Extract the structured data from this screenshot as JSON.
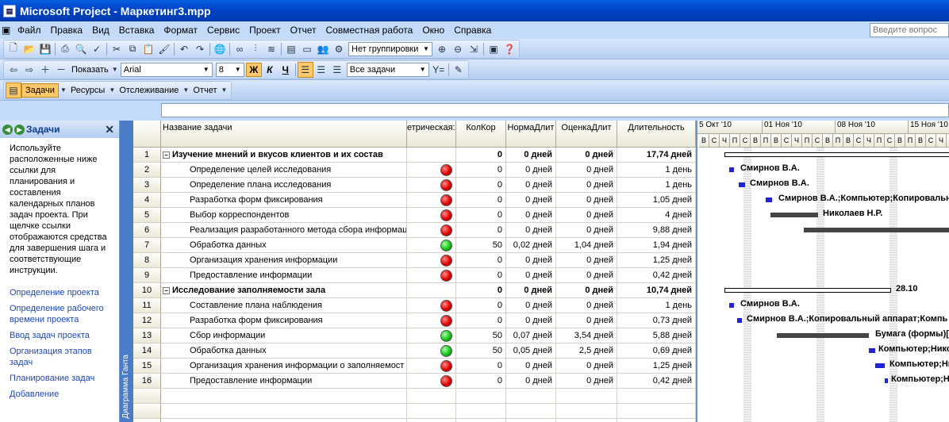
{
  "window": {
    "title": "Microsoft Project - Маркетинг3.mpp",
    "ask_placeholder": "Введите вопрос"
  },
  "menu": [
    "Файл",
    "Правка",
    "Вид",
    "Вставка",
    "Формат",
    "Сервис",
    "Проект",
    "Отчет",
    "Совместная работа",
    "Окно",
    "Справка"
  ],
  "toolbar": {
    "grouping": "Нет группировки",
    "show_label": "Показать",
    "font": "Arial",
    "size": "8",
    "bold": "Ж",
    "italic": "К",
    "underline": "Ч",
    "filter": "Все задачи"
  },
  "viewbar": {
    "tasks": "Задачи",
    "resources": "Ресурсы",
    "tracking": "Отслеживание",
    "report": "Отчет"
  },
  "pane": {
    "title": "Задачи",
    "description": "Используйте расположенные ниже ссылки для планирования и составления календарных планов задач проекта. При щелчке ссылки отображаются средства для завершения шага и соответствующие инструкции.",
    "links": [
      "Определение проекта",
      "Определение рабочего времени проекта",
      "Ввод задач проекта",
      "Организация этапов задач",
      "Планирование задач",
      "Добавление"
    ]
  },
  "vertical_label": "Диаграмма Ганта",
  "columns": [
    "Название задачи",
    "етрическая:",
    "КолКор",
    "НормаДлит",
    "ОценкаДлит",
    "Длительность"
  ],
  "rows": [
    {
      "id": "1",
      "name": "Изучение мнений и вкусов клиентов и их состав",
      "summary": true,
      "ind": "",
      "kk": "0",
      "nd": "0 дней",
      "od": "0 дней",
      "dur": "17,74 дней"
    },
    {
      "id": "2",
      "name": "Определение целей исследования",
      "summary": false,
      "ind": "red",
      "kk": "0",
      "nd": "0 дней",
      "od": "0 дней",
      "dur": "1 день"
    },
    {
      "id": "3",
      "name": "Определение плана исследования",
      "summary": false,
      "ind": "red",
      "kk": "0",
      "nd": "0 дней",
      "od": "0 дней",
      "dur": "1 день"
    },
    {
      "id": "4",
      "name": "Разработка форм фиксирования",
      "summary": false,
      "ind": "red",
      "kk": "0",
      "nd": "0 дней",
      "od": "0 дней",
      "dur": "1,05 дней"
    },
    {
      "id": "5",
      "name": "Выбор корреспондентов",
      "summary": false,
      "ind": "red",
      "kk": "0",
      "nd": "0 дней",
      "od": "0 дней",
      "dur": "4 дней"
    },
    {
      "id": "6",
      "name": "Реализация разработанного метода сбора информац",
      "summary": false,
      "ind": "red",
      "kk": "0",
      "nd": "0 дней",
      "od": "0 дней",
      "dur": "9,88 дней"
    },
    {
      "id": "7",
      "name": "Обработка данных",
      "summary": false,
      "ind": "green",
      "kk": "50",
      "nd": "0,02 дней",
      "od": "1,04 дней",
      "dur": "1,94 дней"
    },
    {
      "id": "8",
      "name": "Организация хранения информации",
      "summary": false,
      "ind": "red",
      "kk": "0",
      "nd": "0 дней",
      "od": "0 дней",
      "dur": "1,25 дней"
    },
    {
      "id": "9",
      "name": "Предоставление информации",
      "summary": false,
      "ind": "red",
      "kk": "0",
      "nd": "0 дней",
      "od": "0 дней",
      "dur": "0,42 дней"
    },
    {
      "id": "10",
      "name": "Исследование заполняемости зала",
      "summary": true,
      "ind": "",
      "kk": "0",
      "nd": "0 дней",
      "od": "0 дней",
      "dur": "10,74 дней"
    },
    {
      "id": "11",
      "name": "Составление плана наблюдения",
      "summary": false,
      "ind": "red",
      "kk": "0",
      "nd": "0 дней",
      "od": "0 дней",
      "dur": "1 день"
    },
    {
      "id": "12",
      "name": "Разработка форм фиксирования",
      "summary": false,
      "ind": "red",
      "kk": "0",
      "nd": "0 дней",
      "od": "0 дней",
      "dur": "0,73 дней"
    },
    {
      "id": "13",
      "name": "Сбор информации",
      "summary": false,
      "ind": "green",
      "kk": "50",
      "nd": "0,07 дней",
      "od": "3,54 дней",
      "dur": "5,88 дней"
    },
    {
      "id": "14",
      "name": "Обработка данных",
      "summary": false,
      "ind": "green",
      "kk": "50",
      "nd": "0,05 дней",
      "od": "2,5 дней",
      "dur": "0,69 дней"
    },
    {
      "id": "15",
      "name": "Организация хранения информации о заполняемост",
      "summary": false,
      "ind": "red",
      "kk": "0",
      "nd": "0 дней",
      "od": "0 дней",
      "dur": "1,25 дней"
    },
    {
      "id": "16",
      "name": "Предоставление информации",
      "summary": false,
      "ind": "red",
      "kk": "0",
      "nd": "0 дней",
      "od": "0 дней",
      "dur": "0,42 дней"
    }
  ],
  "gantt": {
    "weeks": [
      "5 Окт '10",
      "01 Ноя '10",
      "08 Ноя '10",
      "15 Ноя '10"
    ],
    "days": [
      "В",
      "С",
      "Ч",
      "П",
      "С",
      "В",
      "П",
      "В",
      "С",
      "Ч",
      "П",
      "С",
      "В",
      "П",
      "В",
      "С",
      "Ч",
      "П",
      "С",
      "В",
      "П",
      "В",
      "С",
      "Ч",
      "П"
    ],
    "labels": [
      "Смирнов В.А.",
      "Смирнов В.А.",
      "Смирнов В.А.;Компьютер;Копировальн",
      "Николаев Н.Р.",
      "28.10",
      "Смирнов В.А.",
      "Смирнов В.А.;Копировальный аппарат;Компь",
      "Бумага (формы)[",
      "Компьютер;Нико",
      "Компьютер;Ни",
      "Компьютер;Н"
    ]
  }
}
